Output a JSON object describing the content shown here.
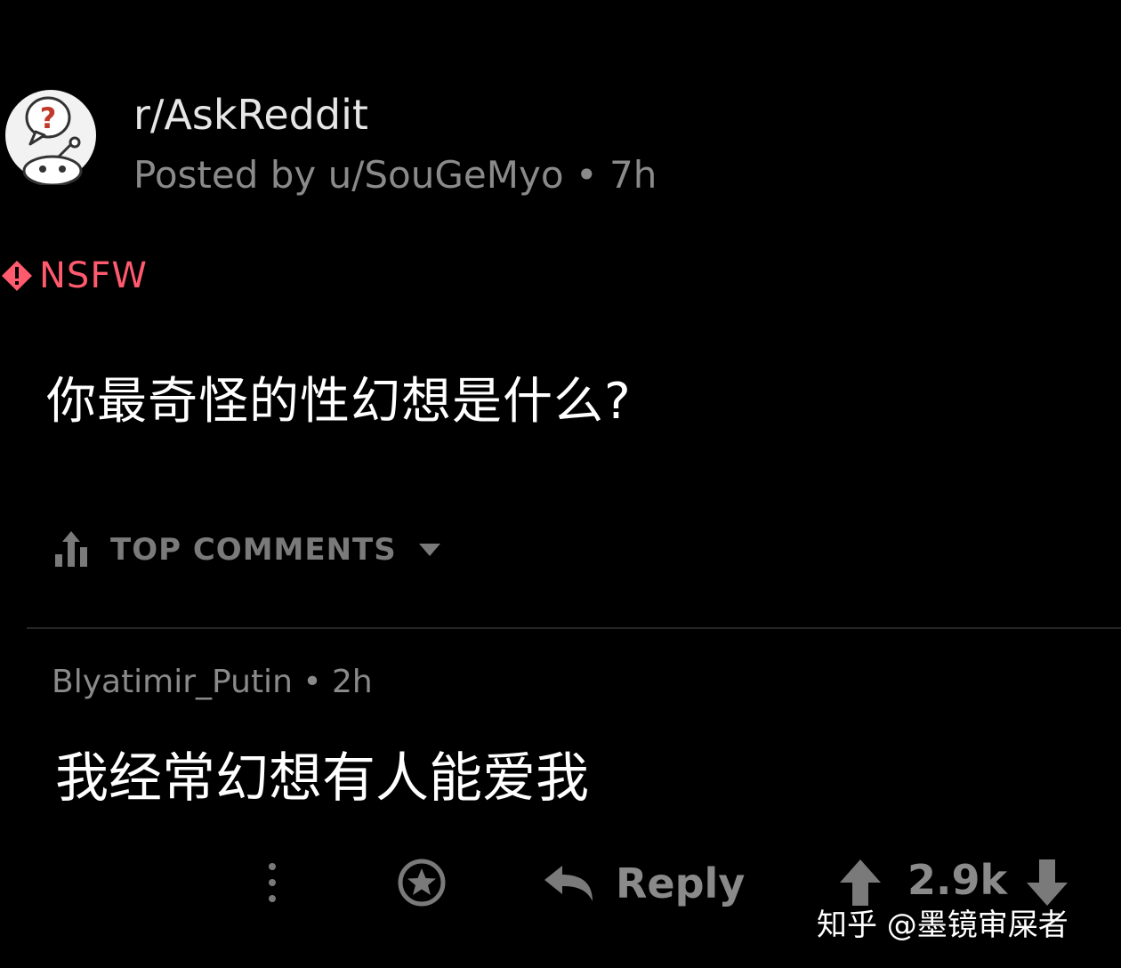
{
  "post": {
    "subreddit": "r/AskReddit",
    "meta": "Posted by u/SouGeMyo • 7h",
    "nsfw_label": "NSFW",
    "title": "你最奇怪的性幻想是什么?"
  },
  "comments_header": {
    "sort_label": "TOP COMMENTS"
  },
  "comment": {
    "meta": "Blyatimir_Putin • 2h",
    "body": "我经常幻想有人能爱我",
    "reply_label": "Reply",
    "score": "2.9k"
  },
  "watermark": "知乎 @墨镜审屎者",
  "colors": {
    "background": "#000000",
    "nsfw": "#ff5a6e",
    "muted": "#8a8a8a"
  },
  "icons": [
    "subreddit-avatar-icon",
    "nsfw-warning-icon",
    "sort-icon",
    "caret-down-icon",
    "more-options-icon",
    "award-icon",
    "reply-icon",
    "upvote-icon",
    "downvote-icon"
  ]
}
